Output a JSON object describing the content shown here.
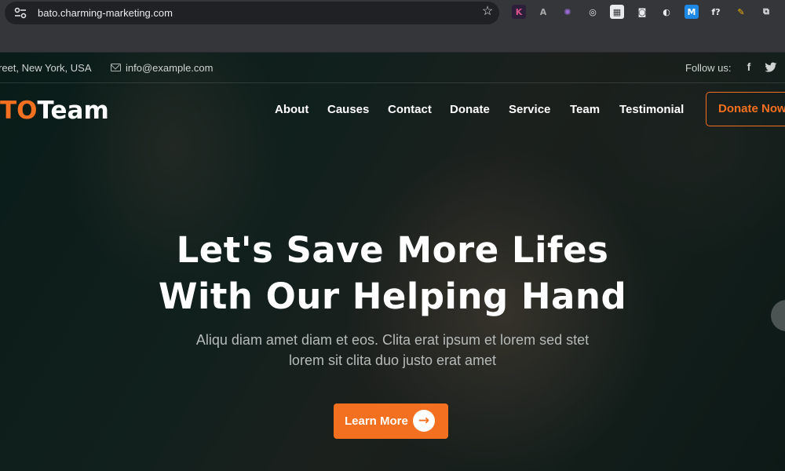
{
  "browser": {
    "url": "bato.charming-marketing.com",
    "extensions": [
      {
        "icon": "k-extension-icon",
        "glyph": "K",
        "bg": "#2b1f3a",
        "fg": "#d94f8a"
      },
      {
        "icon": "a-extension-icon",
        "glyph": "A",
        "bg": "#35363a",
        "fg": "#aaaaaa"
      },
      {
        "icon": "puzzle-gear-icon",
        "glyph": "✺",
        "bg": "#35363a",
        "fg": "#9b6bd6"
      },
      {
        "icon": "target-icon",
        "glyph": "◎",
        "bg": "#35363a",
        "fg": "#e8eaed"
      },
      {
        "icon": "grid-extension-icon",
        "glyph": "▦",
        "bg": "#e8eaed",
        "fg": "#35363a"
      },
      {
        "icon": "camera-icon",
        "glyph": "◙",
        "bg": "#35363a",
        "fg": "#e8eaed"
      },
      {
        "icon": "circle-extension-icon",
        "glyph": "◐",
        "bg": "#35363a",
        "fg": "#e8eaed"
      },
      {
        "icon": "m-extension-icon",
        "glyph": "M",
        "bg": "#1e88e5",
        "fg": "#ffffff"
      },
      {
        "icon": "function-icon",
        "glyph": "f?",
        "bg": "#35363a",
        "fg": "#e8eaed"
      },
      {
        "icon": "pencil-extension-icon",
        "glyph": "✎",
        "bg": "#35363a",
        "fg": "#f0b400"
      },
      {
        "icon": "puzzle-icon",
        "glyph": "⧉",
        "bg": "#35363a",
        "fg": "#e8eaed"
      }
    ]
  },
  "topbar": {
    "address": "reet, New York, USA",
    "email": "info@example.com",
    "follow_label": "Follow us:",
    "social": [
      {
        "icon": "facebook-icon",
        "glyph": "f"
      },
      {
        "icon": "twitter-icon",
        "glyph": "🐦"
      }
    ]
  },
  "logo": {
    "accent": "TO",
    "main": "Team"
  },
  "nav": [
    "About",
    "Causes",
    "Contact",
    "Donate",
    "Service",
    "Team",
    "Testimonial"
  ],
  "donate_button": "Donate Now",
  "hero": {
    "headline_line1": "Let's Save More Lifes",
    "headline_line2": "With Our Helping Hand",
    "subtext_line1": "Aliqu diam amet diam et eos. Clita erat ipsum et lorem sed stet",
    "subtext_line2": "lorem sit clita duo justo erat amet",
    "cta_label": "Learn More",
    "cta_icon": "arrow-right-icon",
    "cta_glyph": "→"
  },
  "colors": {
    "accent": "#f37021"
  }
}
